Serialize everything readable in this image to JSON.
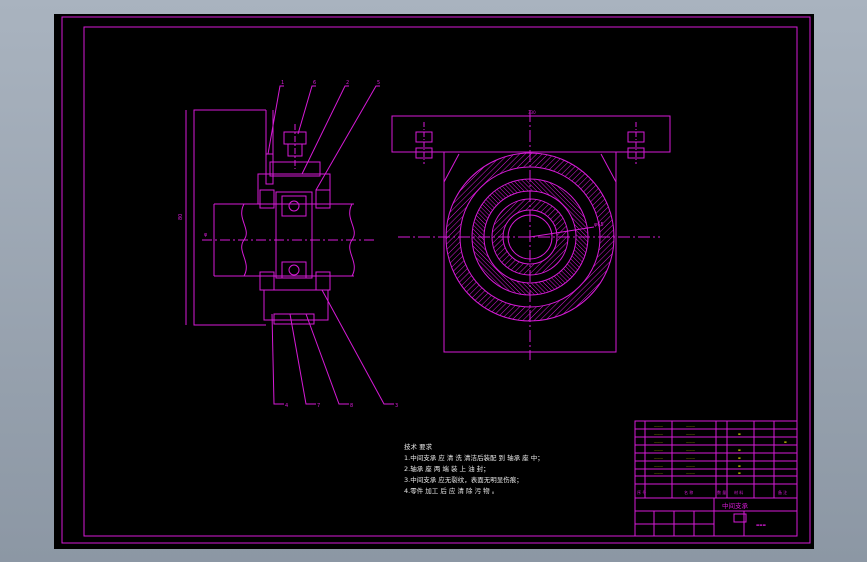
{
  "colors": {
    "background": "#000000",
    "line": "#d61ad6",
    "note_text": "#e8e8e8",
    "table_text": "#e6e600",
    "outer_chrome": "#9aa4b0"
  },
  "technical_requirements": {
    "heading": "技术 要求",
    "items": [
      "1.中间支承 应 清 洗 清洁后装配 到 轴承 座 中；",
      "2.轴承 座 两 端 装 上 油 封；",
      "3.中间支承 应无裂纹，表面无明显伤痕；",
      "4.零件 加工 后 应 清 除 污 物 。"
    ]
  },
  "title_block": {
    "part_name": "中间支承",
    "header_cells": [
      "序 号",
      "名 称",
      "数 量",
      "材 料",
      "备 注"
    ]
  }
}
